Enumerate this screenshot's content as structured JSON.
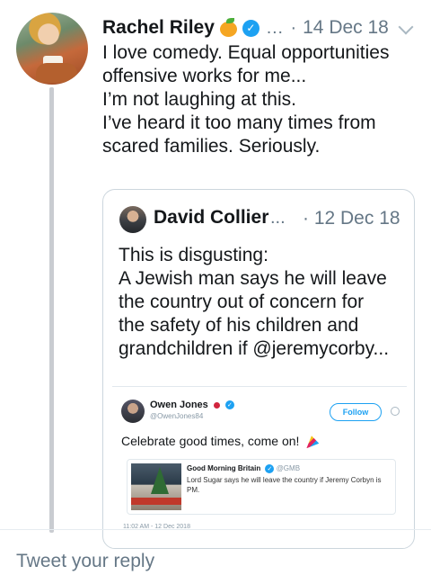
{
  "tweet": {
    "author": "Rachel Riley",
    "ellipsis": "… ·",
    "date": "14 Dec 18",
    "icons": [
      "orange-icon",
      "verified-icon",
      "chevron-down-icon"
    ],
    "lines": [
      "I love comedy. Equal opportunities",
      "offensive works for me...",
      "I’m not laughing at this.",
      "I’ve heard it too many times from",
      "scared families. Seriously."
    ]
  },
  "quoted": {
    "author": "David Collier",
    "ellipsis": "...",
    "date": "· 12 Dec 18",
    "lines": [
      "This is disgusting:",
      "A Jewish man says he will leave",
      "the country out of concern for",
      "the safety of his children and",
      "grandchildren if @jeremycorby..."
    ],
    "embedded": {
      "author": "Owen Jones",
      "handle": "@OwenJones84",
      "follow_label": "Follow",
      "text": "Celebrate good times, come on!",
      "card": {
        "source": "Good Morning Britain",
        "source_handle": "@GMB",
        "text": "Lord Sugar says he will leave the country if Jeremy Corbyn is PM."
      },
      "timestamp": "11:02 AM - 12 Dec 2018"
    }
  },
  "reply": {
    "placeholder": "Tweet your reply"
  },
  "colors": {
    "accent": "#1da1f2",
    "muted": "#657786",
    "thread_line": "#c9ccd1"
  }
}
